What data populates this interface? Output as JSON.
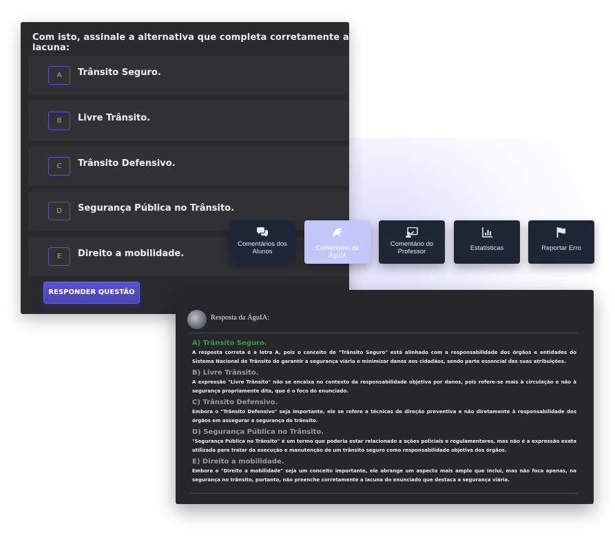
{
  "question": {
    "prompt": "Com isto, assinale a alternativa que completa corretamente a lacuna:",
    "options": [
      {
        "letter": "A",
        "text": "Trânsito Seguro."
      },
      {
        "letter": "B",
        "text": "Livre Trânsito."
      },
      {
        "letter": "C",
        "text": "Trânsito Defensivo."
      },
      {
        "letter": "D",
        "text": "Segurança Pública no Trânsito."
      },
      {
        "letter": "E",
        "text": "Direito a mobilidade."
      }
    ],
    "answer_button": "RESPONDER QUESTÃO"
  },
  "tabs": [
    {
      "label": "Comentários dos Alunos",
      "icon": "comments-icon"
    },
    {
      "label": "Comentário da ÁguIA",
      "icon": "eagle-icon",
      "active": true
    },
    {
      "label": "Comentário do Professor",
      "icon": "teacher-icon"
    },
    {
      "label": "Estatísticas",
      "icon": "chart-icon"
    },
    {
      "label": "Reportar Erro",
      "icon": "flag-icon"
    }
  ],
  "response": {
    "title": "Resposta da ÁguIA:",
    "items": [
      {
        "title": "A) Trânsito Seguro.",
        "body": "A resposta correta é a letra A, pois o conceito de \"Trânsito Seguro\" está alinhado com a responsabilidade dos órgãos e entidades do Sistema Nacional de Trânsito de garantir a segurança viária e minimizar danos aos cidadãos, sendo parte essencial das suas atribuições."
      },
      {
        "title": "B) Livre Trânsito.",
        "body": "A expressão \"Livre Trânsito\" não se encaixa no contexto da responsabilidade objetiva por danos, pois refere-se mais à circulação e não à segurança propriamente dita, que é o foco do enunciado."
      },
      {
        "title": "C) Trânsito Defensivo.",
        "body": "Embora o \"Trânsito Defensivo\" seja importante, ele se refere a técnicas de direção preventiva e não diretamente à responsabilidade dos órgãos em assegurar a segurança do trânsito."
      },
      {
        "title": "D) Segurança Pública no Trânsito.",
        "body": "\"Segurança Pública no Trânsito\" é um termo que poderia estar relacionado a ações policiais e regulamentares, mas não é a expressão exata utilizada para tratar da execução e manutenção de um trânsito seguro como responsabilidade objetiva dos órgãos."
      },
      {
        "title": "E) Direito a mobilidade.",
        "body": "Embora o \"Direito a mobilidade\" seja um conceito importante, ele abrange um aspecto mais amplo que inclui, mas não foca apenas, na segurança no trânsito, portanto, não preenche corretamente a lacuna do enunciado que destaca a segurança viária."
      }
    ]
  },
  "colors": {
    "accent": "#5a52cf",
    "correct": "#2f9e3f",
    "panel": "#2a2a2f",
    "tab": "#1f2638",
    "tab_active": "#c5c6f9"
  }
}
